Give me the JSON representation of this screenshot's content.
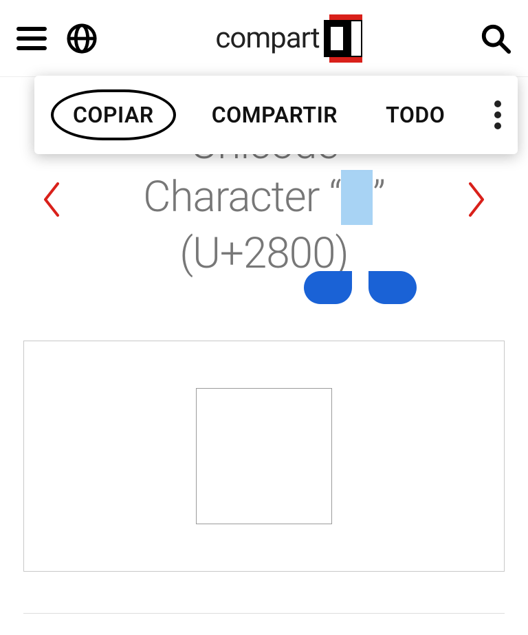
{
  "navbar": {
    "brand_text": "compart"
  },
  "context_menu": {
    "copy": "COPIAR",
    "share": "COMPARTIR",
    "all": "TODO"
  },
  "page": {
    "title_line1": "Unicode",
    "title_line2_pre": "Character “",
    "title_line2_post": "”",
    "title_line3": "(U+2800)",
    "glyph": "⠀"
  }
}
